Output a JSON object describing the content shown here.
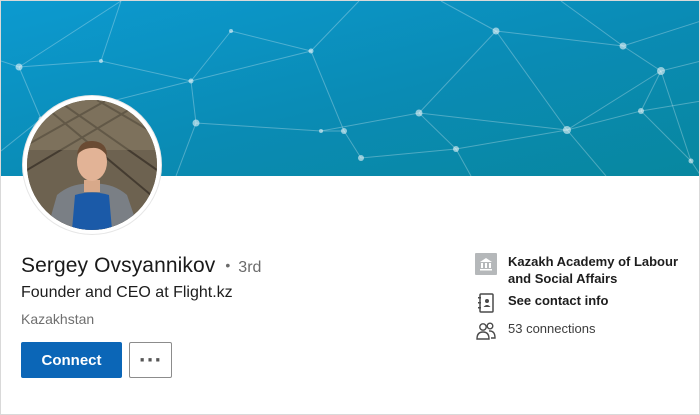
{
  "profile": {
    "name": "Sergey Ovsyannikov",
    "separator": "•",
    "degree": "3rd",
    "headline": "Founder and CEO at Flight.kz",
    "location": "Kazakhstan"
  },
  "actions": {
    "connect_label": "Connect",
    "more_label": "···"
  },
  "sidebar": {
    "school": "Kazakh Academy of Labour and Social Affairs",
    "contact_info": "See contact info",
    "connections": "53 connections"
  },
  "icons": {
    "school": "building-icon",
    "contact": "contact-book-icon",
    "connections": "people-icon"
  },
  "colors": {
    "banner_start": "#0a8fbd",
    "banner_end": "#0a8aa8",
    "connect_button": "#0b66b7"
  }
}
